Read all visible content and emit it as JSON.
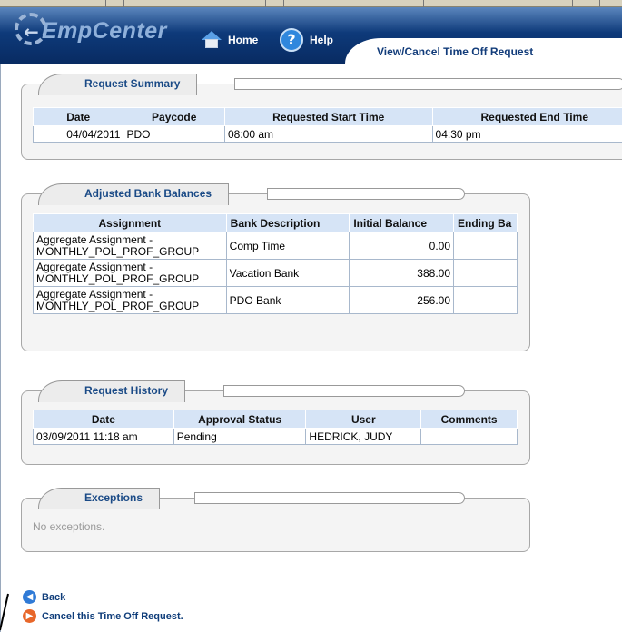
{
  "app": {
    "logo_text": "EmpCenter",
    "home_label": "Home",
    "help_label": "Help",
    "page_title": "View/Cancel Time Off Request"
  },
  "request_summary": {
    "title": "Request Summary",
    "columns": [
      "Date",
      "Paycode",
      "Requested Start Time",
      "Requested End Time"
    ],
    "row": [
      "04/04/2011",
      "PDO",
      "08:00 am",
      "04:30 pm"
    ]
  },
  "bank_balances": {
    "title": "Adjusted Bank Balances",
    "columns": [
      "Assignment",
      "Bank Description",
      "Initial Balance",
      "Ending Ba"
    ],
    "rows": [
      {
        "assign1": "Aggregate Assignment -",
        "assign2": "MONTHLY_POL_PROF_GROUP",
        "bank": "Comp Time",
        "initial": "0.00",
        "ending": ""
      },
      {
        "assign1": "Aggregate Assignment -",
        "assign2": "MONTHLY_POL_PROF_GROUP",
        "bank": "Vacation Bank",
        "initial": "388.00",
        "ending": ""
      },
      {
        "assign1": "Aggregate Assignment -",
        "assign2": "MONTHLY_POL_PROF_GROUP",
        "bank": "PDO Bank",
        "initial": "256.00",
        "ending": ""
      }
    ]
  },
  "request_history": {
    "title": "Request History",
    "columns": [
      "Date",
      "Approval Status",
      "User",
      "Comments"
    ],
    "row": [
      "03/09/2011 11:18 am",
      "Pending",
      "HEDRICK, JUDY",
      ""
    ]
  },
  "exceptions": {
    "title": "Exceptions",
    "empty_text": "No exceptions."
  },
  "links": {
    "back": "Back",
    "cancel": "Cancel this Time Off Request."
  },
  "colors": {
    "header_dark": "#082b62",
    "header_light": "#5b86bd",
    "table_header": "#d6e4f6",
    "section_title": "#1a4a86",
    "back_icon": "#2f7ad6",
    "cancel_icon": "#e8672a"
  }
}
